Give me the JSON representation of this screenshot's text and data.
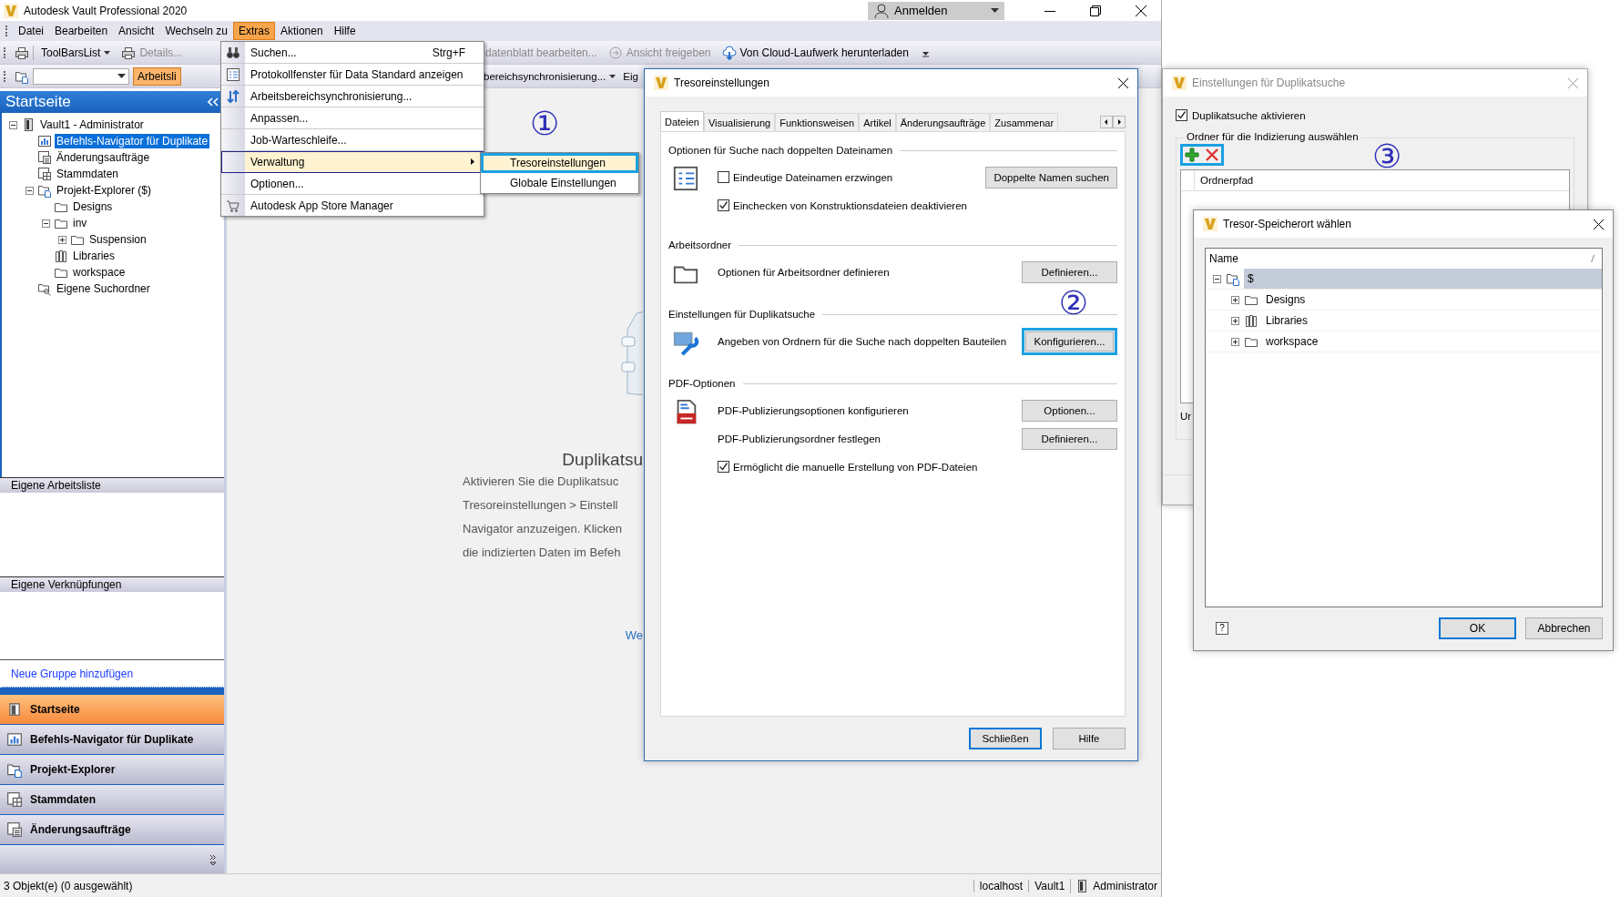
{
  "window": {
    "title": "Autodesk Vault Professional 2020",
    "account": "Anmelden"
  },
  "menu_bar": [
    {
      "label": "Datei",
      "selected": false
    },
    {
      "label": "Bearbeiten",
      "selected": false
    },
    {
      "label": "Ansicht",
      "selected": false
    },
    {
      "label": "Wechseln zu",
      "selected": false
    },
    {
      "label": "Extras",
      "selected": true
    },
    {
      "label": "Aktionen",
      "selected": false
    },
    {
      "label": "Hilfe",
      "selected": false
    }
  ],
  "toolbar_1": {
    "left": [
      {
        "label": "ToolBarsList",
        "dropdown": true,
        "disabled": false
      },
      {
        "label": "Details...",
        "dropdown": false,
        "disabled": true
      }
    ],
    "right": [
      {
        "label": "datenblatt bearbeiten...",
        "dropdown": false,
        "disabled": true
      },
      {
        "label": "Ansicht freigeben",
        "dropdown": false,
        "disabled": true
      },
      {
        "label": "Von Cloud-Laufwerk herunterladen",
        "dropdown": false,
        "disabled": false
      }
    ]
  },
  "toolbar_2": {
    "left": [
      {
        "label": "Arbeitsli",
        "selected": true,
        "dropdown": false
      }
    ],
    "right": [
      {
        "label": "bereichsynchronisierung...",
        "selected": false,
        "dropdown": true
      },
      {
        "label": "Eig",
        "selected": false,
        "dropdown": false
      }
    ]
  },
  "sidebar": {
    "title": "Startseite",
    "tree": [
      {
        "label": "Vault1 - Administrator",
        "kind": "vault",
        "expanded": true,
        "selected": false,
        "children": [
          {
            "label": "Befehls-Navigator für Duplikate",
            "kind": "navigator",
            "selected": true
          },
          {
            "label": "Änderungsaufträge",
            "kind": "changes",
            "selected": false
          },
          {
            "label": "Stammdaten",
            "kind": "masterdata",
            "selected": false
          },
          {
            "label": "Projekt-Explorer ($)",
            "kind": "project",
            "expanded": true,
            "selected": false,
            "children": [
              {
                "label": "Designs",
                "kind": "folder",
                "selected": false
              },
              {
                "label": "inv",
                "kind": "folder",
                "expanded": true,
                "selected": false,
                "children": [
                  {
                    "label": "Suspension",
                    "kind": "folder",
                    "expanded": false,
                    "selected": false
                  }
                ]
              },
              {
                "label": "Libraries",
                "kind": "library",
                "selected": false
              },
              {
                "label": "workspace",
                "kind": "folder",
                "selected": false
              }
            ]
          },
          {
            "label": "Eigene Suchordner",
            "kind": "searchfolder",
            "selected": false
          }
        ]
      }
    ],
    "sections": [
      "Eigene Arbeitsliste",
      "Eigene Verknüpfungen"
    ],
    "add_group_link": "Neue Gruppe hinzufügen",
    "nav_buttons": [
      {
        "label": "Startseite",
        "selected": true
      },
      {
        "label": "Befehls-Navigator für Duplikate",
        "selected": false
      },
      {
        "label": "Projekt-Explorer",
        "selected": false
      },
      {
        "label": "Stammdaten",
        "selected": false
      },
      {
        "label": "Änderungsaufträge",
        "selected": false
      }
    ]
  },
  "content": {
    "title": "Duplikatsu",
    "lines": [
      "Aktivieren Sie die Duplikatsuc",
      "Tresoreinstellungen > Einstell",
      "Navigator anzuzeigen. Klicken",
      "die indizierten Daten im Befeh"
    ],
    "link": "We"
  },
  "status_bar": {
    "text": "3 Objekt(e) (0 ausgewählt)",
    "server": "localhost",
    "vault": "Vault1",
    "user": "Administrator"
  },
  "extras_menu": {
    "step": "①",
    "items": [
      {
        "label": "Suchen...",
        "shortcut": "Strg+F",
        "submenu": false,
        "selected": false
      },
      {
        "label": "Protokollfenster für Data Standard anzeigen",
        "submenu": false,
        "selected": false
      },
      {
        "label": "Arbeitsbereichsynchronisierung...",
        "submenu": false,
        "selected": false
      },
      {
        "label": "Anpassen...",
        "submenu": false,
        "selected": false
      },
      {
        "label": "Job-Warteschleife...",
        "submenu": false,
        "selected": false
      },
      {
        "label": "Verwaltung",
        "submenu": true,
        "selected": true
      },
      {
        "label": "Optionen...",
        "submenu": false,
        "selected": false
      },
      {
        "label": "Autodesk App Store Manager",
        "submenu": false,
        "selected": false
      }
    ],
    "submenu": [
      {
        "label": "Tresoreinstellungen",
        "selected": true,
        "highlighted": true
      },
      {
        "label": "Globale Einstellungen",
        "selected": false,
        "highlighted": false
      }
    ]
  },
  "vault_settings_dialog": {
    "title": "Tresoreinstellungen",
    "step": "②",
    "tabs": [
      {
        "label": "Dateien",
        "selected": true
      },
      {
        "label": "Visualisierung",
        "selected": false
      },
      {
        "label": "Funktionsweisen",
        "selected": false
      },
      {
        "label": "Artikel",
        "selected": false
      },
      {
        "label": "Änderungsaufträge",
        "selected": false
      },
      {
        "label": "Zusammenar",
        "selected": false
      }
    ],
    "sections": [
      {
        "title": "Optionen für Suche nach doppelten Dateinamen",
        "rows": [
          {
            "kind": "checkbox",
            "label": "Eindeutige Dateinamen erzwingen",
            "checked": false,
            "button": "Doppelte Namen suchen",
            "highlighted": false
          },
          {
            "kind": "checkbox",
            "label": "Einchecken von Konstruktionsdateien deaktivieren",
            "checked": true
          }
        ]
      },
      {
        "title": "Arbeitsordner",
        "rows": [
          {
            "kind": "text",
            "label": "Optionen für Arbeitsordner definieren",
            "button": "Definieren...",
            "highlighted": false
          }
        ]
      },
      {
        "title": "Einstellungen für Duplikatsuche",
        "rows": [
          {
            "kind": "text",
            "label": "Angeben von Ordnern für die Suche nach doppelten Bauteilen",
            "button": "Konfigurieren...",
            "highlighted": true
          }
        ]
      },
      {
        "title": "PDF-Optionen",
        "rows": [
          {
            "kind": "text",
            "label": "PDF-Publizierungsoptionen konfigurieren",
            "button": "Optionen...",
            "highlighted": false
          },
          {
            "kind": "text",
            "label": "PDF-Publizierungsordner festlegen",
            "button": "Definieren...",
            "highlighted": false
          },
          {
            "kind": "checkbox",
            "label": "Ermöglicht die manuelle Erstellung von PDF-Dateien",
            "checked": true
          }
        ]
      }
    ],
    "buttons": [
      {
        "label": "Schließen",
        "default": true
      },
      {
        "label": "Hilfe",
        "default": false
      }
    ]
  },
  "duplicate_dialog": {
    "title": "Einstellungen für Duplikatsuche",
    "step": "③",
    "enable": {
      "label": "Duplikatsuche aktivieren",
      "checked": true
    },
    "group": "Ordner für die Indizierung auswählen",
    "toolbar_highlighted": true,
    "column": "Ordnerpfad",
    "footer_text": "Ur"
  },
  "location_dialog": {
    "title": "Tresor-Speicherort wählen",
    "column": "Name",
    "tree": [
      {
        "label": "$",
        "kind": "project",
        "expanded": true,
        "selected": true,
        "children": [
          {
            "label": "Designs",
            "kind": "folder",
            "expanded": false,
            "selected": false
          },
          {
            "label": "Libraries",
            "kind": "library",
            "expanded": false,
            "selected": false
          },
          {
            "label": "workspace",
            "kind": "folder",
            "expanded": false,
            "selected": false
          }
        ]
      }
    ],
    "help": "?",
    "buttons": [
      {
        "label": "OK",
        "default": true
      },
      {
        "label": "Abbrechen",
        "default": false
      }
    ]
  }
}
